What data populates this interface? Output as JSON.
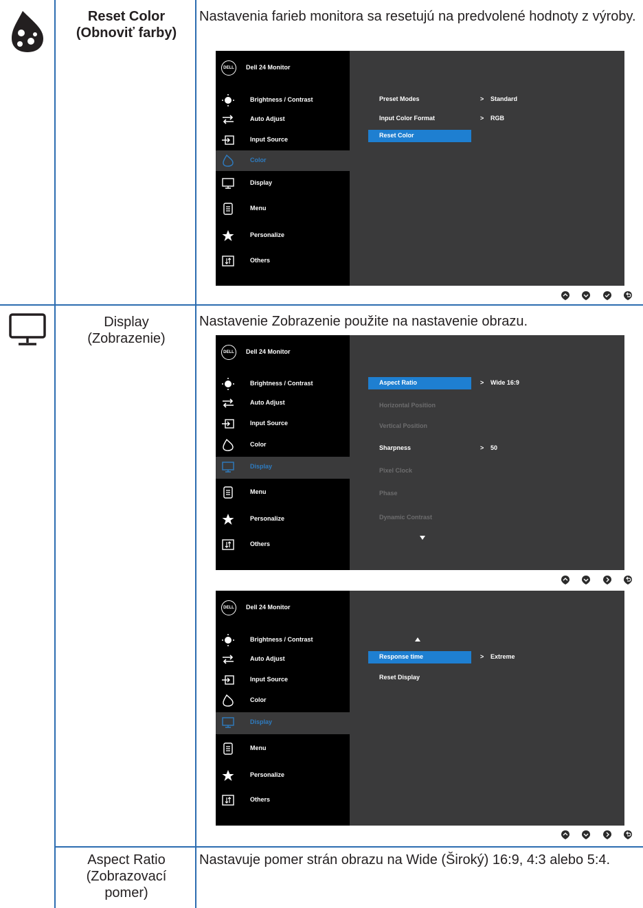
{
  "rows": [
    {
      "label1": "Reset Color",
      "label2": "(Obnoviť farby)",
      "desc": "Nastavenia farieb monitora sa resetujú na predvolené hodnoty z výroby."
    },
    {
      "label1": "Display",
      "label2": "(Zobrazenie)",
      "desc": "Nastavenie Zobrazenie použite na nastavenie obrazu."
    },
    {
      "label1": "Aspect Ratio",
      "label2": "(Zobrazovací",
      "label3": "pomer)",
      "desc": "Nastavuje pomer strán obrazu na Wide (Široký) 16:9, 4:3 alebo 5:4."
    }
  ],
  "osd": {
    "logo": "DELL",
    "title": "Dell 24 Monitor",
    "menu": [
      "Brightness / Contrast",
      "Auto Adjust",
      "Input Source",
      "Color",
      "Display",
      "Menu",
      "Personalize",
      "Others"
    ],
    "color_panel": [
      {
        "label": "Preset Modes",
        "arrow": ">",
        "value": "Standard"
      },
      {
        "label": "Input Color Format",
        "arrow": ">",
        "value": "RGB"
      },
      {
        "label": "Reset Color"
      }
    ],
    "display_panel1": [
      {
        "label": "Aspect Ratio",
        "arrow": ">",
        "value": "Wide  16:9"
      },
      {
        "label": "Horizontal Position"
      },
      {
        "label": "Vertical Position"
      },
      {
        "label": "Sharpness",
        "arrow": ">",
        "value": "50"
      },
      {
        "label": "Pixel Clock"
      },
      {
        "label": "Phase"
      },
      {
        "label": "Dynamic Contrast"
      }
    ],
    "display_panel2": [
      {
        "label": "Response time",
        "arrow": ">",
        "value": "Extreme"
      },
      {
        "label": "Reset Display"
      }
    ]
  },
  "colors": {
    "accent": "#2b6cb0",
    "osd_bg": "#3a3a3b",
    "highlight": "#1e7fd1"
  }
}
